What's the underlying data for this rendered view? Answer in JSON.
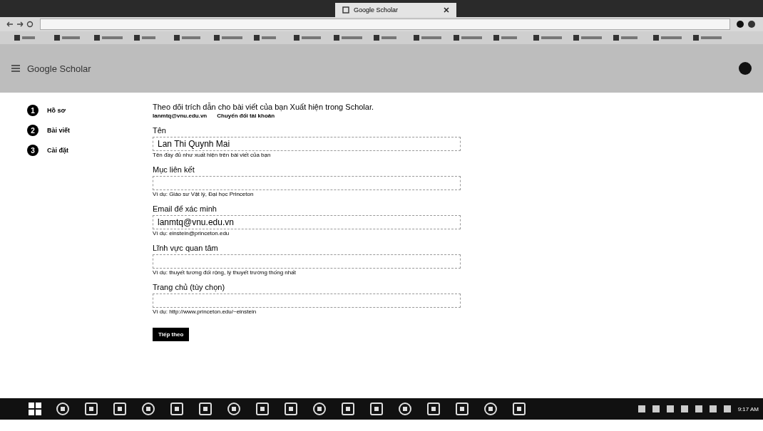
{
  "browser": {
    "tab_title": "Google Scholar"
  },
  "header": {
    "title": "Google Scholar"
  },
  "steps": [
    {
      "number": "1",
      "label": "Hồ sơ"
    },
    {
      "number": "2",
      "label": "Bài viết"
    },
    {
      "number": "3",
      "label": "Cài đặt"
    }
  ],
  "intro": {
    "text": "Theo dõi trích dẫn cho bài viết của bạn  Xuất hiện trong Scholar.",
    "email": "lanmtq@vnu.edu.vn",
    "switch_link": "Chuyển đổi tài khoản"
  },
  "fields": [
    {
      "label": "Tên",
      "value": "Lan Thi Quynh Mai",
      "hint": "Tên đầy đủ như xuất hiện trên bài viết của bạn"
    },
    {
      "label": "Mục liên kết",
      "hint": "Ví dụ: Giáo sư Vật lý, Đại học Princeton"
    },
    {
      "label": "Email để xác minh",
      "value": "lanmtq@vnu.edu.vn",
      "hint": "Ví dụ: einstein@princeton.edu"
    },
    {
      "label": "Lĩnh vực quan tâm",
      "hint": "Ví dụ: thuyết tương đối rộng, lý thuyết trường thống nhất"
    },
    {
      "label": "Trang chủ (tùy chọn)",
      "hint": "Ví dụ: http://www.princeton.edu/~einstein"
    }
  ],
  "next_button": "Tiếp theo",
  "taskbar": {
    "clock": "9:17 AM"
  }
}
